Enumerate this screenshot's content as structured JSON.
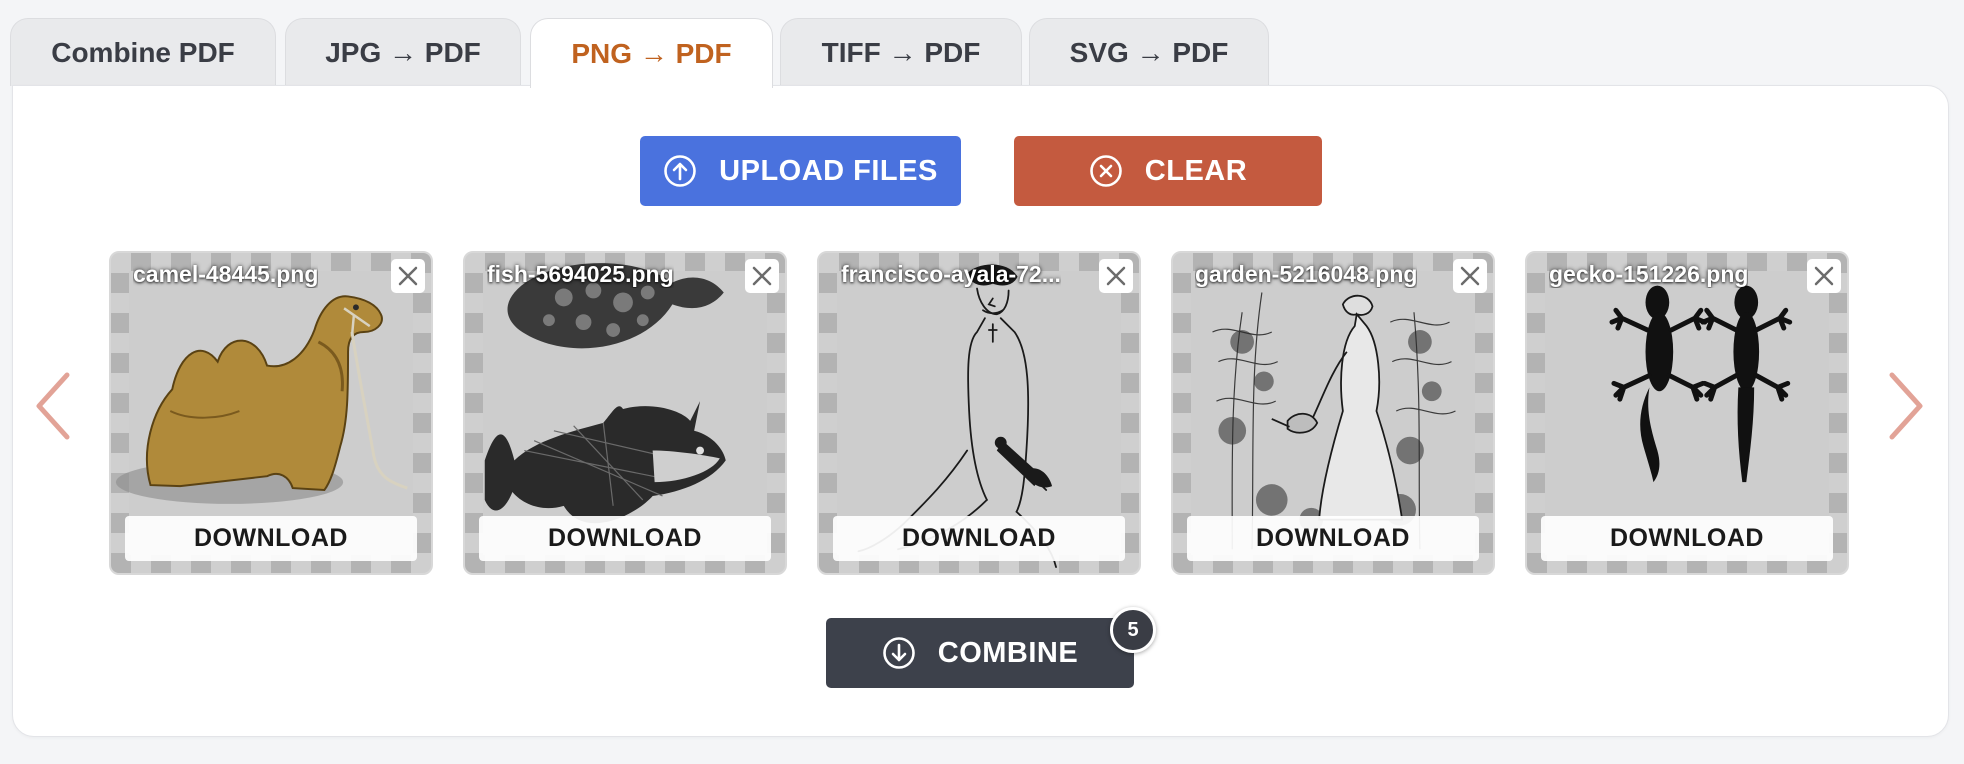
{
  "tabs": [
    {
      "label": "Combine PDF",
      "active": false
    },
    {
      "label": "JPG → PDF",
      "active": false
    },
    {
      "label": "PNG → PDF",
      "active": true
    },
    {
      "label": "TIFF → PDF",
      "active": false
    },
    {
      "label": "SVG → PDF",
      "active": false
    }
  ],
  "actions": {
    "upload_label": "UPLOAD FILES",
    "clear_label": "CLEAR",
    "combine_label": "COMBINE",
    "file_count": "5"
  },
  "files": [
    {
      "name": "camel-48445.png",
      "download_label": "DOWNLOAD"
    },
    {
      "name": "fish-5694025.png",
      "download_label": "DOWNLOAD"
    },
    {
      "name": "francisco-ayala-72...",
      "download_label": "DOWNLOAD"
    },
    {
      "name": "garden-5216048.png",
      "download_label": "DOWNLOAD"
    },
    {
      "name": "gecko-151226.png",
      "download_label": "DOWNLOAD"
    }
  ],
  "icons": {
    "upload": "arrow-up-circle-icon",
    "clear": "x-circle-icon",
    "combine": "arrow-down-circle-icon",
    "prev": "chevron-left-icon",
    "next": "chevron-right-icon",
    "remove": "close-icon"
  },
  "colors": {
    "active_tab": "#c0621f",
    "upload": "#4a72de",
    "clear": "#c45a3f",
    "combine": "#3d414b",
    "arrows": "#e2a397"
  }
}
